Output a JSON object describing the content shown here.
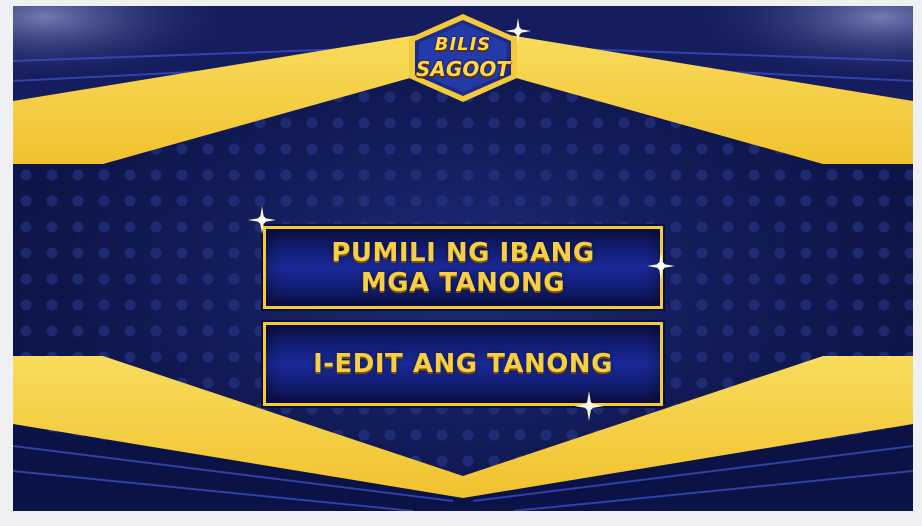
{
  "logo": {
    "line1": "BILIS",
    "line2": "SAGOOT"
  },
  "menu": {
    "other_questions_label": "PUMILI NG IBANG\nMGA TANONG",
    "edit_question_label": "I-EDIT ANG TANONG"
  },
  "colors": {
    "accent_gold": "#f4c93c",
    "background_navy": "#111a55"
  },
  "icons": [
    "sparkle-icon"
  ]
}
